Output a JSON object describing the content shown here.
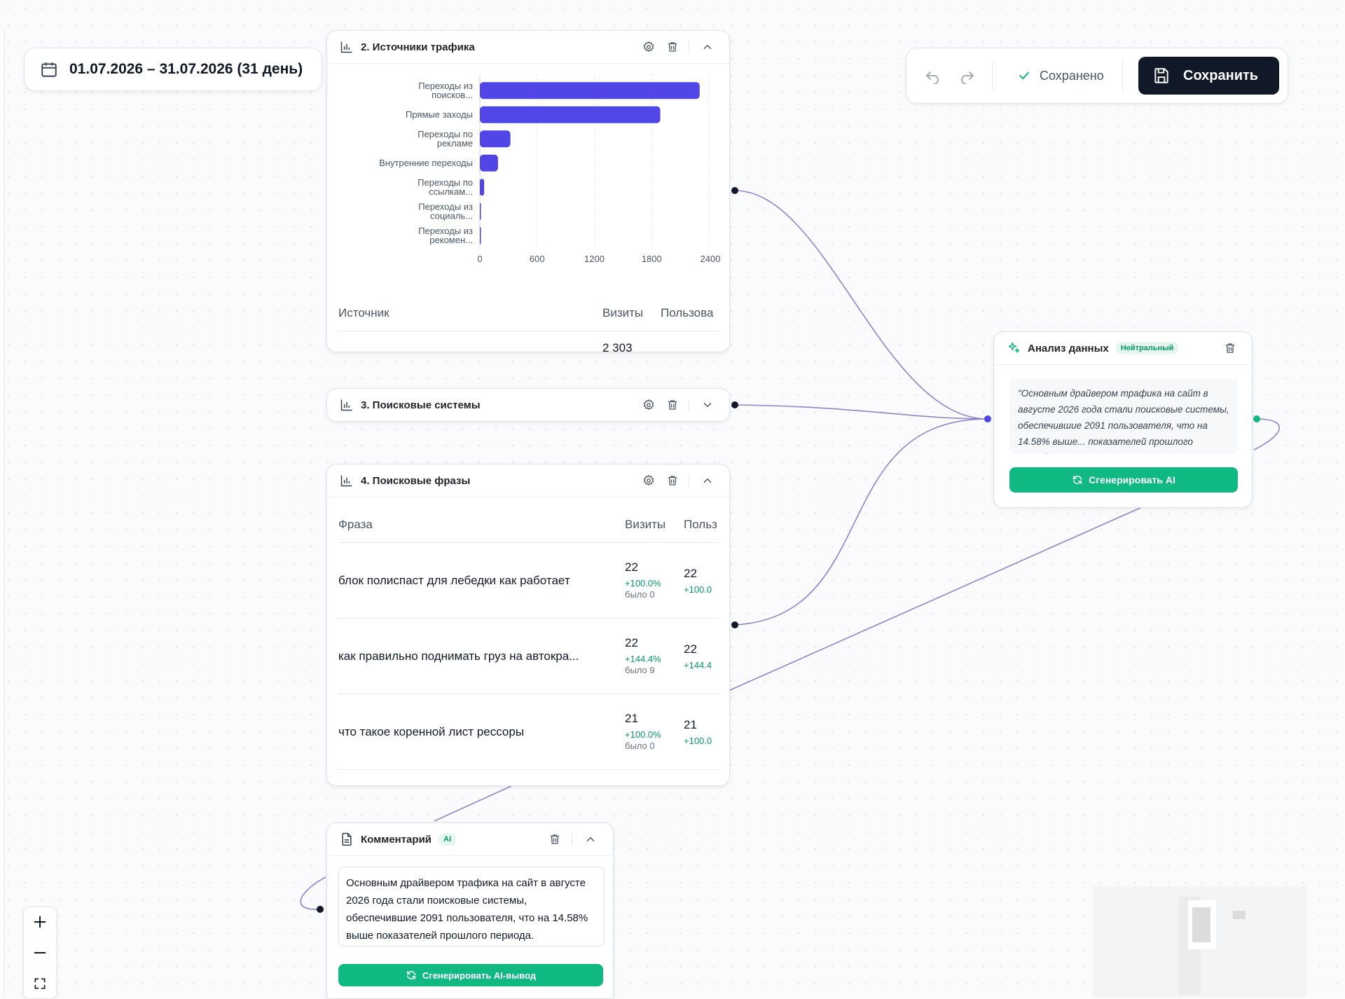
{
  "date_range": {
    "label": "01.07.2026 – 31.07.2026 (31 день)"
  },
  "toolbar": {
    "saved_label": "Сохранено",
    "save_label": "Сохранить"
  },
  "traffic_card": {
    "title": "2. Источники трафика",
    "table": {
      "headers": [
        "Источник",
        "Визиты",
        "Пользова"
      ],
      "partial_value": "2 303"
    }
  },
  "chart_data": {
    "type": "bar",
    "orientation": "horizontal",
    "categories": [
      "Переходы из поисков...",
      "Прямые заходы",
      "Переходы по рекламе",
      "Внутренние переходы",
      "Переходы по ссылкам...",
      "Переходы из социаль...",
      "Переходы из рекомен..."
    ],
    "category_lines": [
      [
        "Переходы из",
        "поисков..."
      ],
      [
        "Прямые заходы"
      ],
      [
        "Переходы по",
        "рекламе"
      ],
      [
        "Внутренние переходы"
      ],
      [
        "Переходы по",
        "ссылкам..."
      ],
      [
        "Переходы из",
        "социаль..."
      ],
      [
        "Переходы из",
        "рекомен..."
      ]
    ],
    "values": [
      2303,
      1890,
      320,
      190,
      45,
      5,
      3
    ],
    "xticks": [
      0,
      600,
      1200,
      1800,
      2400
    ],
    "xlim": [
      0,
      2400
    ],
    "grid": true,
    "bar_color": "#4f46e5"
  },
  "search_engines_card": {
    "title": "3. Поисковые системы"
  },
  "phrases_card": {
    "title": "4. Поисковые фразы",
    "headers": [
      "Фраза",
      "Визиты",
      "Польз"
    ],
    "rows": [
      {
        "phrase": "блок полиспаст для лебедки как работает",
        "visits": "22",
        "visits_change": "+100.0%",
        "visits_was": "было 0",
        "users": "22",
        "users_change": "+100.0"
      },
      {
        "phrase": "как правильно поднимать груз на автокра...",
        "visits": "22",
        "visits_change": "+144.4%",
        "visits_was": "было 9",
        "users": "22",
        "users_change": "+144.4"
      },
      {
        "phrase": "что такое коренной лист рессоры",
        "visits": "21",
        "visits_change": "+100.0%",
        "visits_was": "было 0",
        "users": "21",
        "users_change": "+100.0"
      }
    ]
  },
  "analysis_card": {
    "title": "Анализ данных",
    "badge": "Нейтральный",
    "quote": "\"Основным драйвером трафика на сайт в августе 2026 года стали поисковые системы, обеспечившие 2091 пользователя, что на 14.58% выше... показателей прошлого периода. В",
    "button": "Сгенерировать AI"
  },
  "comment_card": {
    "title": "Комментарий",
    "badge": "AI",
    "text": "Основным драйвером трафика на сайт в августе 2026 года стали поисковые системы, обеспечившие 2091 пользователя, что на 14.58% выше показателей прошлого периода.",
    "button": "Сгенерировать AI-вывод"
  },
  "colors": {
    "accent": "#4f46e5",
    "success": "#10b981",
    "dark": "#111827",
    "edge": "#8b85c9"
  },
  "icons": [
    "calendar-icon",
    "undo-icon",
    "redo-icon",
    "check-icon",
    "save-icon",
    "bar-chart-icon",
    "gear-icon",
    "trash-icon",
    "chevron-up-icon",
    "chevron-down-icon",
    "sparkles-icon",
    "refresh-icon",
    "document-icon",
    "plus-icon",
    "minus-icon",
    "fit-view-icon"
  ]
}
